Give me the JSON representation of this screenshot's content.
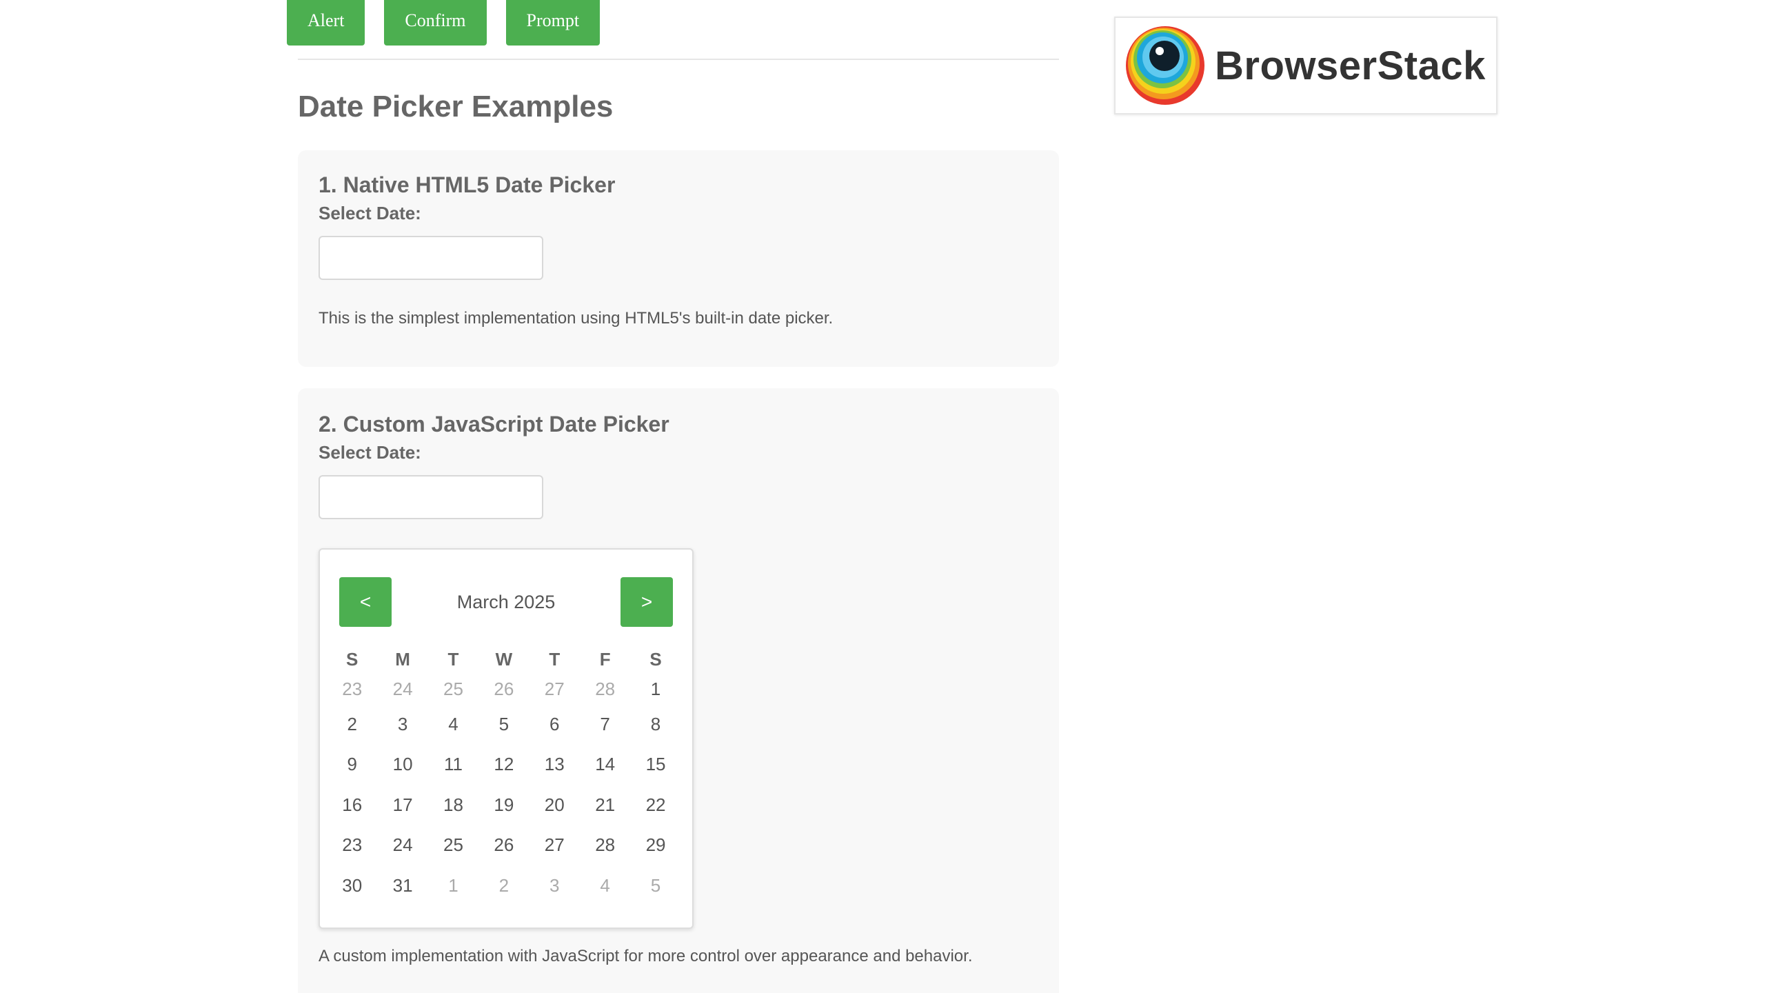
{
  "top_buttons": {
    "alert_label": "Alert",
    "confirm_label": "Confirm",
    "prompt_label": "Prompt"
  },
  "page_title": "Date Picker Examples",
  "section1": {
    "title": "1. Native HTML5 Date Picker",
    "label": "Select Date:",
    "input_value": "",
    "description": "This is the simplest implementation using HTML5's built-in date picker."
  },
  "section2": {
    "title": "2. Custom JavaScript Date Picker",
    "label": "Select Date:",
    "input_value": "",
    "description": "A custom implementation with JavaScript for more control over appearance and behavior."
  },
  "calendar": {
    "prev_label": "<",
    "next_label": ">",
    "month_label": "March 2025",
    "weekdays": [
      "S",
      "M",
      "T",
      "W",
      "T",
      "F",
      "S"
    ],
    "weeks": [
      [
        {
          "d": "23",
          "other": true
        },
        {
          "d": "24",
          "other": true
        },
        {
          "d": "25",
          "other": true
        },
        {
          "d": "26",
          "other": true
        },
        {
          "d": "27",
          "other": true
        },
        {
          "d": "28",
          "other": true
        },
        {
          "d": "1",
          "other": false
        }
      ],
      [
        {
          "d": "2",
          "other": false
        },
        {
          "d": "3",
          "other": false
        },
        {
          "d": "4",
          "other": false
        },
        {
          "d": "5",
          "other": false
        },
        {
          "d": "6",
          "other": false
        },
        {
          "d": "7",
          "other": false
        },
        {
          "d": "8",
          "other": false
        }
      ],
      [
        {
          "d": "9",
          "other": false
        },
        {
          "d": "10",
          "other": false
        },
        {
          "d": "11",
          "other": false
        },
        {
          "d": "12",
          "other": false
        },
        {
          "d": "13",
          "other": false
        },
        {
          "d": "14",
          "other": false
        },
        {
          "d": "15",
          "other": false
        }
      ],
      [
        {
          "d": "16",
          "other": false
        },
        {
          "d": "17",
          "other": false
        },
        {
          "d": "18",
          "other": false
        },
        {
          "d": "19",
          "other": false
        },
        {
          "d": "20",
          "other": false
        },
        {
          "d": "21",
          "other": false
        },
        {
          "d": "22",
          "other": false
        }
      ],
      [
        {
          "d": "23",
          "other": false
        },
        {
          "d": "24",
          "other": false
        },
        {
          "d": "25",
          "other": false
        },
        {
          "d": "26",
          "other": false
        },
        {
          "d": "27",
          "other": false
        },
        {
          "d": "28",
          "other": false
        },
        {
          "d": "29",
          "other": false
        }
      ],
      [
        {
          "d": "30",
          "other": false
        },
        {
          "d": "31",
          "other": false
        },
        {
          "d": "1",
          "other": true
        },
        {
          "d": "2",
          "other": true
        },
        {
          "d": "3",
          "other": true
        },
        {
          "d": "4",
          "other": true
        },
        {
          "d": "5",
          "other": true
        }
      ]
    ]
  },
  "logo": {
    "text": "BrowserStack",
    "icon": "browserstack-logo-icon"
  },
  "colors": {
    "accent_green": "#4caf50",
    "other_month_day": "#aaaaaa",
    "panel_background": "#f8f8f8"
  }
}
